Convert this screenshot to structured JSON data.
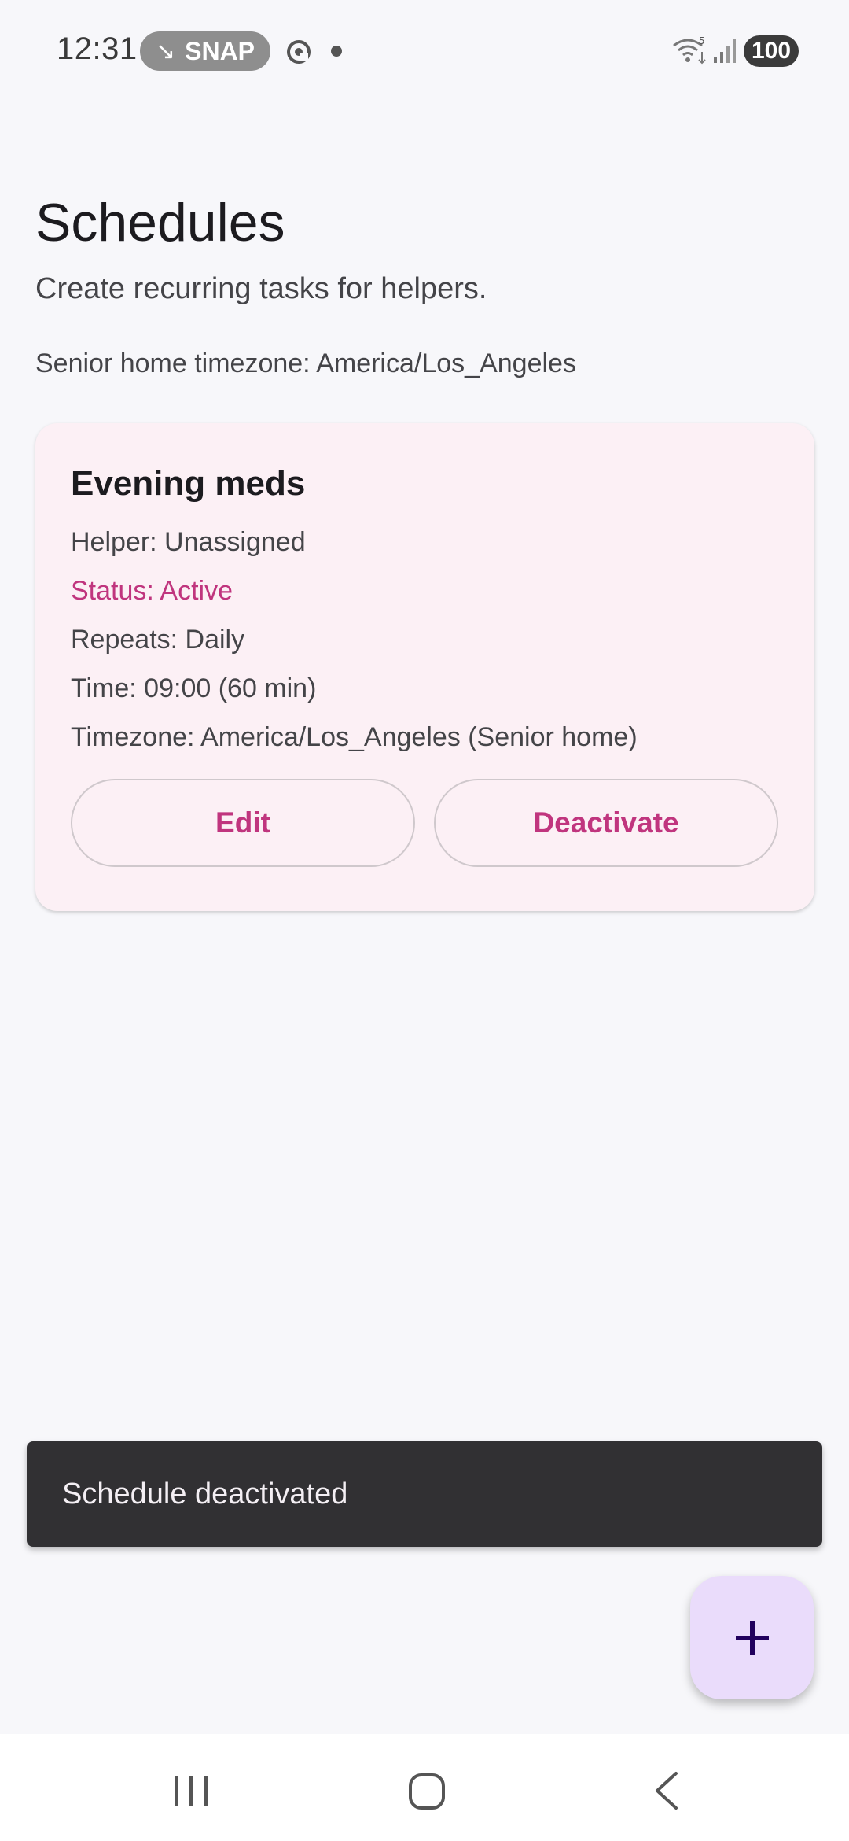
{
  "status_bar": {
    "time": "12:31",
    "snap_label": "SNAP",
    "battery": "100",
    "wifi_badge": "5"
  },
  "header": {
    "title": "Schedules",
    "subtitle": "Create recurring tasks for helpers.",
    "timezone_note": "Senior home timezone: America/Los_Angeles"
  },
  "schedule_card": {
    "title": "Evening meds",
    "helper": "Helper: Unassigned",
    "status": "Status: Active",
    "repeats": "Repeats: Daily",
    "time": "Time: 09:00 (60 min)",
    "timezone": "Timezone: America/Los_Angeles (Senior home)",
    "edit_label": "Edit",
    "deactivate_label": "Deactivate"
  },
  "snackbar": {
    "message": "Schedule deactivated"
  },
  "fab": {
    "icon": "plus-icon"
  },
  "colors": {
    "accent": "#c0357e",
    "card_bg": "#fcf0f5",
    "fab_bg": "#eadcfb",
    "snackbar_bg": "#313033"
  }
}
